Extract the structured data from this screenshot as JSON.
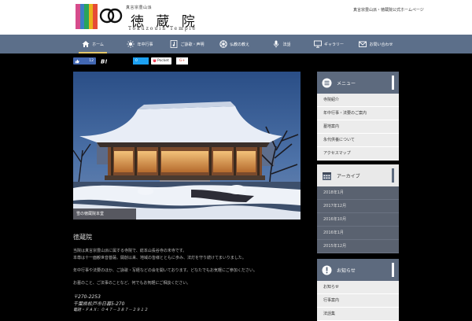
{
  "header": {
    "stripe_colors": [
      "#d64c8c",
      "#3c7ec5",
      "#2aa45a",
      "#e9b21c",
      "#e64b36"
    ],
    "kana": "真言宗豊山派",
    "title": "徳 蔵 院",
    "subtitle": "Tokuzouin Temple",
    "tagline": "真言宗豊山派・徳蔵院公式ホームページ"
  },
  "nav": [
    {
      "icon": "home-icon",
      "label": "ホーム"
    },
    {
      "icon": "sun-icon",
      "label": "年中行事"
    },
    {
      "icon": "music-icon",
      "label": "ご詠歌・声明"
    },
    {
      "icon": "dharma-wheel-icon",
      "label": "仏教の教え"
    },
    {
      "icon": "microphone-icon",
      "label": "法話"
    },
    {
      "icon": "monitor-icon",
      "label": "ギャラリー"
    },
    {
      "icon": "mail-icon",
      "label": "お問い合わせ"
    }
  ],
  "share": {
    "like_count": "12",
    "pocket_count": "0",
    "pocket_label": "Pocket",
    "gplus_label": "G+"
  },
  "photo": {
    "caption": "雪の徳蔵院本堂"
  },
  "content": {
    "title": "徳蔵院",
    "paragraphs": [
      "当院は真言宗豊山派に属する寺院で、総本山長谷寺の末寺です。",
      "本尊は十一面観世音菩薩。開創以来、地域の皆様とともに歩み、法灯を守り続けてまいりました。",
      "年中行事や法要のほか、ご詠歌・写経などの会を開いております。どなたでもお気軽にご参加ください。",
      "お墓のこと、ご法事のことなど、何でもお気軽にご相談ください。"
    ],
    "postal": "〒270-2253",
    "address": "千葉県松戸市日暮5-270",
    "phone": "電話・ＦＡＸ：０４７－３８７－２９１２"
  },
  "sidebar": {
    "menu": {
      "title": "メニュー",
      "items": [
        "寺院紹介",
        "年中行事・法要のご案内",
        "墓地案内",
        "永代供養について",
        "アクセスマップ"
      ]
    },
    "archive": {
      "title": "アーカイブ",
      "items": [
        "2018年1月",
        "2017年12月",
        "2016年10月",
        "2016年1月",
        "2015年12月"
      ]
    },
    "info": {
      "title": "お知らせ",
      "items": [
        "お知らせ",
        "行事案内",
        "法話集"
      ]
    }
  }
}
